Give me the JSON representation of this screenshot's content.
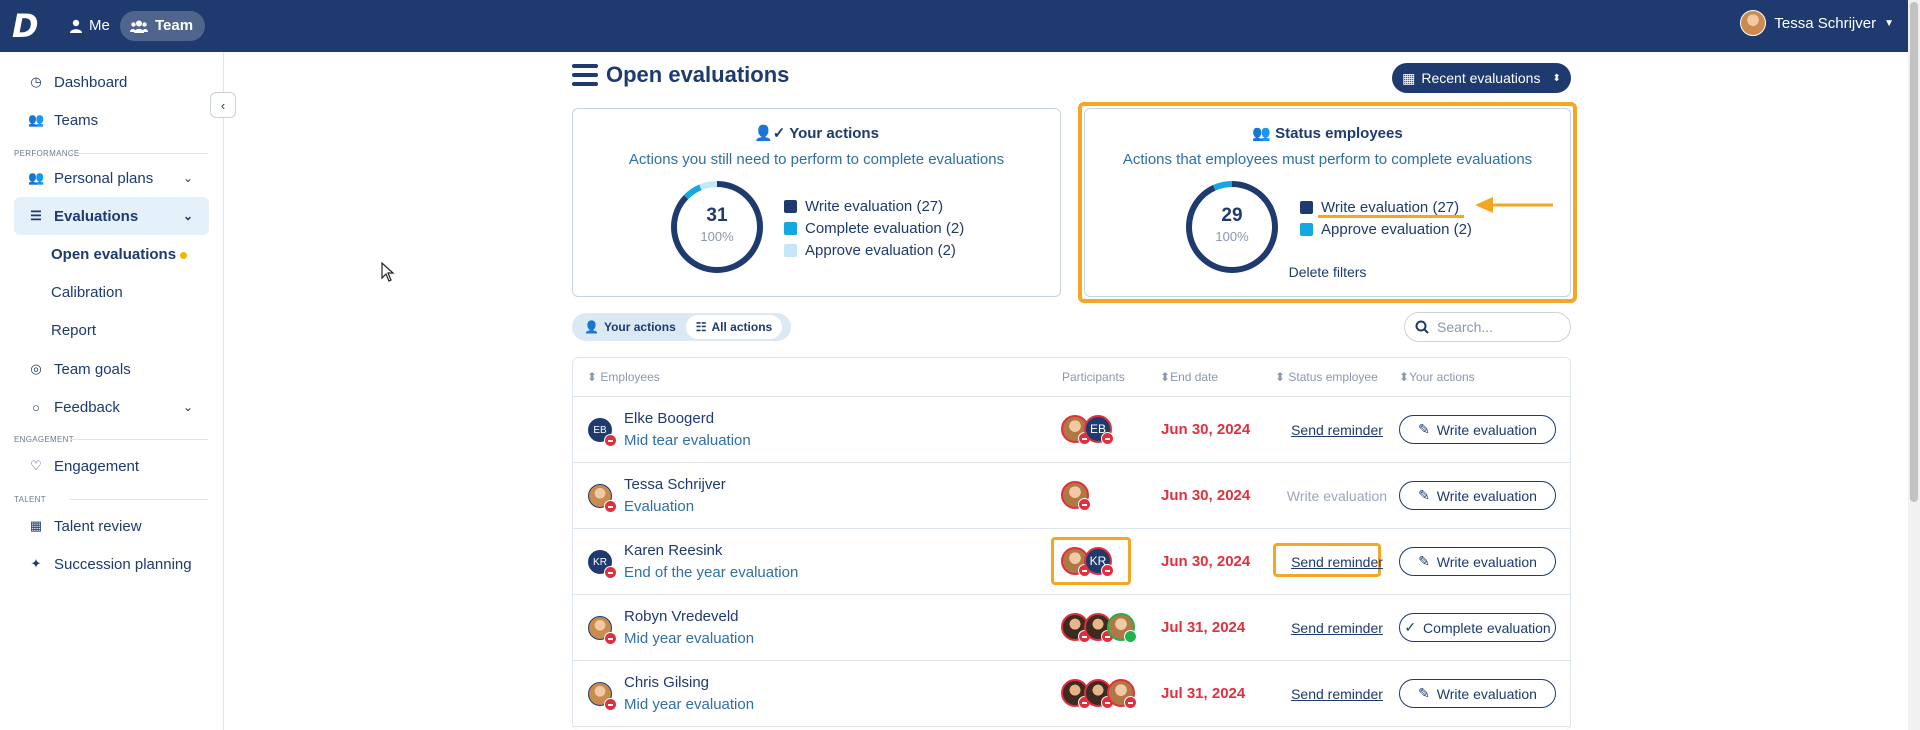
{
  "topbar": {
    "logo": "D",
    "nav": [
      {
        "label": "Me",
        "icon": "person-icon"
      },
      {
        "label": "Team",
        "icon": "team-icon"
      }
    ],
    "user_name": "Tessa Schrijver"
  },
  "sidebar": {
    "items": [
      {
        "label": "Dashboard",
        "icon": "dashboard-icon"
      },
      {
        "label": "Teams",
        "icon": "team-icon"
      }
    ],
    "section_performance": "PERFORMANCE",
    "performance_items": [
      {
        "label": "Personal plans",
        "icon": "team-icon"
      },
      {
        "label": "Evaluations",
        "icon": "list-icon"
      }
    ],
    "evaluation_subitems": [
      "Open evaluations",
      "Calibration",
      "Report"
    ],
    "more_items": [
      {
        "label": "Team goals",
        "icon": "target-icon"
      },
      {
        "label": "Feedback",
        "icon": "chat-icon"
      }
    ],
    "section_engagement": "ENGAGEMENT",
    "engagement_items": [
      {
        "label": "Engagement",
        "icon": "heart-icon"
      }
    ],
    "section_talent": "TALENT",
    "talent_items": [
      {
        "label": "Talent review",
        "icon": "grid-icon"
      },
      {
        "label": "Succession planning",
        "icon": "sparkle-icon"
      }
    ]
  },
  "main": {
    "title": "Open evaluations",
    "recent_button": "Recent evaluations",
    "your_actions_card": {
      "title": "Your actions",
      "subtitle": "Actions you still need to perform to complete evaluations",
      "total": "31",
      "percent": "100%",
      "legend": [
        {
          "label": "Write evaluation (27)",
          "color": "#1e3a6e",
          "value": 27
        },
        {
          "label": "Complete evaluation (2)",
          "color": "#15a8e0",
          "value": 2
        },
        {
          "label": "Approve evaluation (2)",
          "color": "#c4e6f6",
          "value": 2
        }
      ]
    },
    "status_card": {
      "title": "Status employees",
      "subtitle": "Actions that employees must perform to complete evaluations",
      "total": "29",
      "percent": "100%",
      "legend": [
        {
          "label": "Write evaluation (27)",
          "color": "#1e3a6e",
          "value": 27
        },
        {
          "label": "Approve evaluation (2)",
          "color": "#15a8e0",
          "value": 2
        }
      ],
      "delete_filters": "Delete filters"
    },
    "toggle": {
      "your_actions": "Your actions",
      "all_actions": "All actions"
    },
    "search_placeholder": "Search...",
    "table": {
      "headers": [
        "Employees",
        "Participants",
        "End date",
        "Status employee",
        "Your actions"
      ],
      "rows": [
        {
          "initials": "EB",
          "name": "Elke Boogerd",
          "evaluation": "Mid tear evaluation",
          "end_date": "Jun 30, 2024",
          "status": "Send reminder",
          "action": "Write evaluation"
        },
        {
          "initials": "",
          "name": "Tessa Schrijver",
          "evaluation": "Evaluation",
          "end_date": "Jun 30, 2024",
          "status": "Write evaluation",
          "action": "Write evaluation"
        },
        {
          "initials": "KR",
          "name": "Karen Reesink",
          "evaluation": "End of the year evaluation",
          "end_date": "Jun 30, 2024",
          "status": "Send reminder",
          "action": "Write evaluation"
        },
        {
          "initials": "",
          "name": "Robyn Vredeveld",
          "evaluation": "Mid year evaluation",
          "end_date": "Jul 31, 2024",
          "status": "Send reminder",
          "action": "Complete evaluation"
        },
        {
          "initials": "",
          "name": "Chris Gilsing",
          "evaluation": "Mid year evaluation",
          "end_date": "Jul 31, 2024",
          "status": "Send reminder",
          "action": "Write evaluation"
        }
      ]
    }
  },
  "colors": {
    "primary": "#1e3a6e",
    "highlight": "#f5a623",
    "danger": "#e0303e",
    "accent": "#15a8e0"
  }
}
